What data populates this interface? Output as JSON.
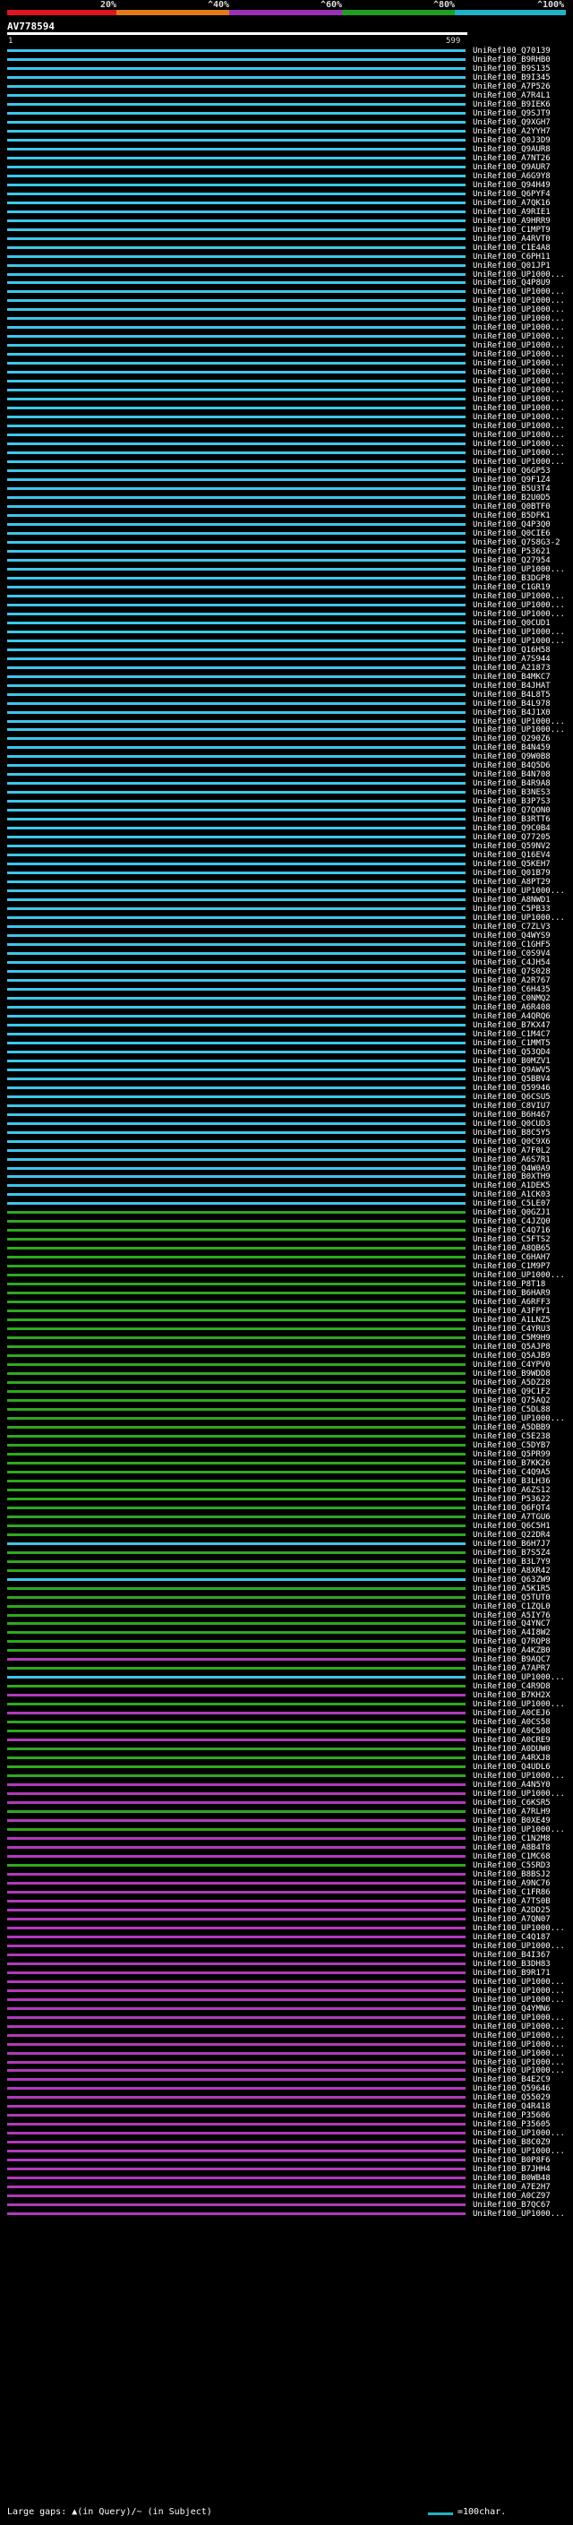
{
  "scale_colors": [
    "#e0141e",
    "#e07b1a",
    "#9b2fb8",
    "#1f9e1f",
    "#20b2c8"
  ],
  "scale_labels": [
    "20%",
    "^40%",
    "^60%",
    "^80%",
    "^100%"
  ],
  "query": {
    "name": "AV778594",
    "start": "1",
    "end": "599"
  },
  "hit_colors": {
    "cyan": "#3ec6ea",
    "green": "#2fa81f",
    "magenta": "#b23aba"
  },
  "hits": [
    {
      "label": "UniRef100_Q70139",
      "c": "cyan"
    },
    {
      "label": "UniRef100_B9RHB0",
      "c": "cyan"
    },
    {
      "label": "UniRef100_B9S135",
      "c": "cyan"
    },
    {
      "label": "UniRef100_B9I345",
      "c": "cyan"
    },
    {
      "label": "UniRef100_A7P526",
      "c": "cyan"
    },
    {
      "label": "UniRef100_A7R4L1",
      "c": "cyan"
    },
    {
      "label": "UniRef100_B9IEK6",
      "c": "cyan"
    },
    {
      "label": "UniRef100_Q9SJT9",
      "c": "cyan"
    },
    {
      "label": "UniRef100_Q9XGH7",
      "c": "cyan"
    },
    {
      "label": "UniRef100_A2YYH7",
      "c": "cyan"
    },
    {
      "label": "UniRef100_Q0J3D9",
      "c": "cyan"
    },
    {
      "label": "UniRef100_Q9AUR8",
      "c": "cyan"
    },
    {
      "label": "UniRef100_A7NT26",
      "c": "cyan"
    },
    {
      "label": "UniRef100_Q9AUR7",
      "c": "cyan"
    },
    {
      "label": "UniRef100_A6G9Y8",
      "c": "cyan"
    },
    {
      "label": "UniRef100_Q94H49",
      "c": "cyan"
    },
    {
      "label": "UniRef100_Q6PYF4",
      "c": "cyan"
    },
    {
      "label": "UniRef100_A7QK16",
      "c": "cyan"
    },
    {
      "label": "UniRef100_A9RIE1",
      "c": "cyan"
    },
    {
      "label": "UniRef100_A9HRR9",
      "c": "cyan"
    },
    {
      "label": "UniRef100_C1MPT9",
      "c": "cyan"
    },
    {
      "label": "UniRef100_A4RVT0",
      "c": "cyan"
    },
    {
      "label": "UniRef100_C1E4A8",
      "c": "cyan"
    },
    {
      "label": "UniRef100_C6PH11",
      "c": "cyan"
    },
    {
      "label": "UniRef100_Q01JP1",
      "c": "cyan"
    },
    {
      "label": "UniRef100_UP1000...",
      "c": "cyan"
    },
    {
      "label": "UniRef100_Q4P8U9",
      "c": "cyan"
    },
    {
      "label": "UniRef100_UP1000...",
      "c": "cyan"
    },
    {
      "label": "UniRef100_UP1000...",
      "c": "cyan"
    },
    {
      "label": "UniRef100_UP1000...",
      "c": "cyan"
    },
    {
      "label": "UniRef100_UP1000...",
      "c": "cyan"
    },
    {
      "label": "UniRef100_UP1000...",
      "c": "cyan"
    },
    {
      "label": "UniRef100_UP1000...",
      "c": "cyan"
    },
    {
      "label": "UniRef100_UP1000...",
      "c": "cyan"
    },
    {
      "label": "UniRef100_UP1000...",
      "c": "cyan"
    },
    {
      "label": "UniRef100_UP1000...",
      "c": "cyan"
    },
    {
      "label": "UniRef100_UP1000...",
      "c": "cyan"
    },
    {
      "label": "UniRef100_UP1000...",
      "c": "cyan"
    },
    {
      "label": "UniRef100_UP1000...",
      "c": "cyan"
    },
    {
      "label": "UniRef100_UP1000...",
      "c": "cyan"
    },
    {
      "label": "UniRef100_UP1000...",
      "c": "cyan"
    },
    {
      "label": "UniRef100_UP1000...",
      "c": "cyan"
    },
    {
      "label": "UniRef100_UP1000...",
      "c": "cyan"
    },
    {
      "label": "UniRef100_UP1000...",
      "c": "cyan"
    },
    {
      "label": "UniRef100_UP1000...",
      "c": "cyan"
    },
    {
      "label": "UniRef100_UP1000...",
      "c": "cyan"
    },
    {
      "label": "UniRef100_UP1000...",
      "c": "cyan"
    },
    {
      "label": "UniRef100_Q6GP53",
      "c": "cyan"
    },
    {
      "label": "UniRef100_Q9F1Z4",
      "c": "cyan"
    },
    {
      "label": "UniRef100_B5U3T4",
      "c": "cyan"
    },
    {
      "label": "UniRef100_B2U0D5",
      "c": "cyan"
    },
    {
      "label": "UniRef100_Q0BTF0",
      "c": "cyan"
    },
    {
      "label": "UniRef100_B5DFK1",
      "c": "cyan"
    },
    {
      "label": "UniRef100_Q4P3Q0",
      "c": "cyan"
    },
    {
      "label": "UniRef100_Q0CIE6",
      "c": "cyan"
    },
    {
      "label": "UniRef100_Q7S8G3-2",
      "c": "cyan"
    },
    {
      "label": "UniRef100_P53621",
      "c": "cyan"
    },
    {
      "label": "UniRef100_Q27954",
      "c": "cyan"
    },
    {
      "label": "UniRef100_UP1000...",
      "c": "cyan"
    },
    {
      "label": "UniRef100_B3DGP8",
      "c": "cyan"
    },
    {
      "label": "UniRef100_C1GR19",
      "c": "cyan"
    },
    {
      "label": "UniRef100_UP1000...",
      "c": "cyan"
    },
    {
      "label": "UniRef100_UP1000...",
      "c": "cyan"
    },
    {
      "label": "UniRef100_UP1000...",
      "c": "cyan"
    },
    {
      "label": "UniRef100_Q0CUD1",
      "c": "cyan"
    },
    {
      "label": "UniRef100_UP1000...",
      "c": "cyan"
    },
    {
      "label": "UniRef100_UP1000...",
      "c": "cyan"
    },
    {
      "label": "UniRef100_Q16H58",
      "c": "cyan"
    },
    {
      "label": "UniRef100_A7S944",
      "c": "cyan"
    },
    {
      "label": "UniRef100_A21873",
      "c": "cyan"
    },
    {
      "label": "UniRef100_B4MKC7",
      "c": "cyan"
    },
    {
      "label": "UniRef100_B4JHAT",
      "c": "cyan"
    },
    {
      "label": "UniRef100_B4L8T5",
      "c": "cyan"
    },
    {
      "label": "UniRef100_B4L978",
      "c": "cyan"
    },
    {
      "label": "UniRef100_B4J1X0",
      "c": "cyan"
    },
    {
      "label": "UniRef100_UP1000...",
      "c": "cyan"
    },
    {
      "label": "UniRef100_UP1000...",
      "c": "cyan"
    },
    {
      "label": "UniRef100_Q290Z6",
      "c": "cyan"
    },
    {
      "label": "UniRef100_B4N459",
      "c": "cyan"
    },
    {
      "label": "UniRef100_Q9W0B8",
      "c": "cyan"
    },
    {
      "label": "UniRef100_B4Q5D6",
      "c": "cyan"
    },
    {
      "label": "UniRef100_B4N708",
      "c": "cyan"
    },
    {
      "label": "UniRef100_B4R9A8",
      "c": "cyan"
    },
    {
      "label": "UniRef100_B3NES3",
      "c": "cyan"
    },
    {
      "label": "UniRef100_B3P7S3",
      "c": "cyan"
    },
    {
      "label": "UniRef100_Q7QON0",
      "c": "cyan"
    },
    {
      "label": "UniRef100_B3RTT6",
      "c": "cyan"
    },
    {
      "label": "UniRef100_Q9C0B4",
      "c": "cyan"
    },
    {
      "label": "UniRef100_Q77205",
      "c": "cyan"
    },
    {
      "label": "UniRef100_Q59NV2",
      "c": "cyan"
    },
    {
      "label": "UniRef100_Q16EV4",
      "c": "cyan"
    },
    {
      "label": "UniRef100_Q5KEH7",
      "c": "cyan"
    },
    {
      "label": "UniRef100_Q01B79",
      "c": "cyan"
    },
    {
      "label": "UniRef100_A8PT29",
      "c": "cyan"
    },
    {
      "label": "UniRef100_UP1000...",
      "c": "cyan"
    },
    {
      "label": "UniRef100_A8NWD1",
      "c": "cyan"
    },
    {
      "label": "UniRef100_C5PB33",
      "c": "cyan"
    },
    {
      "label": "UniRef100_UP1000...",
      "c": "cyan"
    },
    {
      "label": "UniRef100_C7ZLV3",
      "c": "cyan"
    },
    {
      "label": "UniRef100_Q4WYS9",
      "c": "cyan"
    },
    {
      "label": "UniRef100_C1GHF5",
      "c": "cyan"
    },
    {
      "label": "UniRef100_C0S9V4",
      "c": "cyan"
    },
    {
      "label": "UniRef100_C4JH54",
      "c": "cyan"
    },
    {
      "label": "UniRef100_Q7S028",
      "c": "cyan"
    },
    {
      "label": "UniRef100_A2R767",
      "c": "cyan"
    },
    {
      "label": "UniRef100_C6H435",
      "c": "cyan"
    },
    {
      "label": "UniRef100_C0NMQ2",
      "c": "cyan"
    },
    {
      "label": "UniRef100_A6R408",
      "c": "cyan"
    },
    {
      "label": "UniRef100_A4QRQ6",
      "c": "cyan"
    },
    {
      "label": "UniRef100_B7KX47",
      "c": "cyan"
    },
    {
      "label": "UniRef100_C1M4C7",
      "c": "cyan"
    },
    {
      "label": "UniRef100_C1MMT5",
      "c": "cyan"
    },
    {
      "label": "UniRef100_Q53QD4",
      "c": "cyan"
    },
    {
      "label": "UniRef100_B0MZV1",
      "c": "cyan"
    },
    {
      "label": "UniRef100_Q9AWV5",
      "c": "cyan"
    },
    {
      "label": "UniRef100_Q5BBV4",
      "c": "cyan"
    },
    {
      "label": "UniRef100_Q59946",
      "c": "cyan"
    },
    {
      "label": "UniRef100_Q6CSU5",
      "c": "cyan"
    },
    {
      "label": "UniRef100_C8VIU7",
      "c": "cyan"
    },
    {
      "label": "UniRef100_B6H467",
      "c": "cyan"
    },
    {
      "label": "UniRef100_Q0CUD3",
      "c": "cyan"
    },
    {
      "label": "UniRef100_B8C5Y5",
      "c": "cyan"
    },
    {
      "label": "UniRef100_Q0C9X6",
      "c": "cyan"
    },
    {
      "label": "UniRef100_A7F0L2",
      "c": "cyan"
    },
    {
      "label": "UniRef100_A6S7R1",
      "c": "cyan"
    },
    {
      "label": "UniRef100_Q4W0A9",
      "c": "cyan"
    },
    {
      "label": "UniRef100_B0XTH9",
      "c": "cyan"
    },
    {
      "label": "UniRef100_A1DEK5",
      "c": "cyan"
    },
    {
      "label": "UniRef100_A1CK03",
      "c": "cyan"
    },
    {
      "label": "UniRef100_C5LE07",
      "c": "cyan"
    },
    {
      "label": "UniRef100_Q0GZJ1",
      "c": "green"
    },
    {
      "label": "UniRef100_C4JZQ0",
      "c": "green"
    },
    {
      "label": "UniRef100_C4Q716",
      "c": "green"
    },
    {
      "label": "UniRef100_C5FTS2",
      "c": "green"
    },
    {
      "label": "UniRef100_A8QB65",
      "c": "green"
    },
    {
      "label": "UniRef100_C6HAH7",
      "c": "green"
    },
    {
      "label": "UniRef100_C1M9P7",
      "c": "green"
    },
    {
      "label": "UniRef100_UP1000...",
      "c": "green"
    },
    {
      "label": "UniRef100_P8T18",
      "c": "green"
    },
    {
      "label": "UniRef100_B6HAR9",
      "c": "green"
    },
    {
      "label": "UniRef100_A6RFF3",
      "c": "green"
    },
    {
      "label": "UniRef100_A3FPY1",
      "c": "green"
    },
    {
      "label": "UniRef100_A1LNZ5",
      "c": "green"
    },
    {
      "label": "UniRef100_C4YRU3",
      "c": "green"
    },
    {
      "label": "UniRef100_C5M9H9",
      "c": "green"
    },
    {
      "label": "UniRef100_Q5AJP8",
      "c": "green"
    },
    {
      "label": "UniRef100_Q5AJB9",
      "c": "green"
    },
    {
      "label": "UniRef100_C4YPV0",
      "c": "green"
    },
    {
      "label": "UniRef100_B9WDD8",
      "c": "green"
    },
    {
      "label": "UniRef100_A5DZ28",
      "c": "green"
    },
    {
      "label": "UniRef100_Q9C1F2",
      "c": "green"
    },
    {
      "label": "UniRef100_Q75AQ2",
      "c": "green"
    },
    {
      "label": "UniRef100_C5DL88",
      "c": "green"
    },
    {
      "label": "UniRef100_UP1000...",
      "c": "green"
    },
    {
      "label": "UniRef100_A5DBB9",
      "c": "green"
    },
    {
      "label": "UniRef100_C5E238",
      "c": "green"
    },
    {
      "label": "UniRef100_C5DYB7",
      "c": "green"
    },
    {
      "label": "UniRef100_Q5PR99",
      "c": "green"
    },
    {
      "label": "UniRef100_B7KK26",
      "c": "green"
    },
    {
      "label": "UniRef100_C4Q9A5",
      "c": "green"
    },
    {
      "label": "UniRef100_B3LH36",
      "c": "green"
    },
    {
      "label": "UniRef100_A6ZS12",
      "c": "green"
    },
    {
      "label": "UniRef100_P53622",
      "c": "green"
    },
    {
      "label": "UniRef100_Q6FQT4",
      "c": "green"
    },
    {
      "label": "UniRef100_A7TGU6",
      "c": "green"
    },
    {
      "label": "UniRef100_Q6C5H1",
      "c": "green"
    },
    {
      "label": "UniRef100_Q22DR4",
      "c": "green"
    },
    {
      "label": "UniRef100_B6H7J7",
      "c": "cyan"
    },
    {
      "label": "UniRef100_B7S5Z4",
      "c": "green"
    },
    {
      "label": "UniRef100_B3L7Y9",
      "c": "green"
    },
    {
      "label": "UniRef100_A8XR42",
      "c": "green"
    },
    {
      "label": "UniRef100_Q63ZW9",
      "c": "cyan"
    },
    {
      "label": "UniRef100_A5K1R5",
      "c": "green"
    },
    {
      "label": "UniRef100_Q5TUT0",
      "c": "green"
    },
    {
      "label": "UniRef100_C1ZQL0",
      "c": "green"
    },
    {
      "label": "UniRef100_A5IY76",
      "c": "green"
    },
    {
      "label": "UniRef100_Q4YNC7",
      "c": "green"
    },
    {
      "label": "UniRef100_A4I8W2",
      "c": "green"
    },
    {
      "label": "UniRef100_Q7RQP8",
      "c": "green"
    },
    {
      "label": "UniRef100_A4KZB0",
      "c": "green"
    },
    {
      "label": "UniRef100_B9AQC7",
      "c": "magenta"
    },
    {
      "label": "UniRef100_A7APR7",
      "c": "green"
    },
    {
      "label": "UniRef100_UP1000...",
      "c": "cyan"
    },
    {
      "label": "UniRef100_C4R9D8",
      "c": "green"
    },
    {
      "label": "UniRef100_B7KH2X",
      "c": "magenta"
    },
    {
      "label": "UniRef100_UP1000...",
      "c": "green"
    },
    {
      "label": "UniRef100_A0CEJ6",
      "c": "magenta"
    },
    {
      "label": "UniRef100_A0CS58",
      "c": "green"
    },
    {
      "label": "UniRef100_A0C508",
      "c": "green"
    },
    {
      "label": "UniRef100_A0CRE9",
      "c": "magenta"
    },
    {
      "label": "UniRef100_A0DUW0",
      "c": "green"
    },
    {
      "label": "UniRef100_A4RXJ8",
      "c": "green"
    },
    {
      "label": "UniRef100_Q4UDL6",
      "c": "green"
    },
    {
      "label": "UniRef100_UP1000...",
      "c": "green"
    },
    {
      "label": "UniRef100_A4N5Y0",
      "c": "magenta"
    },
    {
      "label": "UniRef100_UP1000...",
      "c": "magenta"
    },
    {
      "label": "UniRef100_C6KSR5",
      "c": "magenta"
    },
    {
      "label": "UniRef100_A7RLH9",
      "c": "green"
    },
    {
      "label": "UniRef100_B0XE49",
      "c": "magenta"
    },
    {
      "label": "UniRef100_UP1000...",
      "c": "green"
    },
    {
      "label": "UniRef100_C1N2M8",
      "c": "magenta"
    },
    {
      "label": "UniRef100_A8B4T8",
      "c": "magenta"
    },
    {
      "label": "UniRef100_C1MC68",
      "c": "magenta"
    },
    {
      "label": "UniRef100_C5SRD3",
      "c": "green"
    },
    {
      "label": "UniRef100_B8BSJ2",
      "c": "magenta"
    },
    {
      "label": "UniRef100_A9NC76",
      "c": "magenta"
    },
    {
      "label": "UniRef100_C1FR86",
      "c": "magenta"
    },
    {
      "label": "UniRef100_A7TS0B",
      "c": "magenta"
    },
    {
      "label": "UniRef100_A2DD25",
      "c": "magenta"
    },
    {
      "label": "UniRef100_A7QN07",
      "c": "magenta"
    },
    {
      "label": "UniRef100_UP1000...",
      "c": "magenta"
    },
    {
      "label": "UniRef100_C4Q187",
      "c": "magenta"
    },
    {
      "label": "UniRef100_UP1000...",
      "c": "magenta"
    },
    {
      "label": "UniRef100_B4I367",
      "c": "magenta"
    },
    {
      "label": "UniRef100_B3DH83",
      "c": "magenta"
    },
    {
      "label": "UniRef100_B9R171",
      "c": "magenta"
    },
    {
      "label": "UniRef100_UP1000...",
      "c": "magenta"
    },
    {
      "label": "UniRef100_UP1000...",
      "c": "magenta"
    },
    {
      "label": "UniRef100_UP1000...",
      "c": "magenta"
    },
    {
      "label": "UniRef100_Q4YMN6",
      "c": "magenta"
    },
    {
      "label": "UniRef100_UP1000...",
      "c": "magenta"
    },
    {
      "label": "UniRef100_UP1000...",
      "c": "magenta"
    },
    {
      "label": "UniRef100_UP1000...",
      "c": "magenta"
    },
    {
      "label": "UniRef100_UP1000...",
      "c": "magenta"
    },
    {
      "label": "UniRef100_UP1000...",
      "c": "magenta"
    },
    {
      "label": "UniRef100_UP1000...",
      "c": "magenta"
    },
    {
      "label": "UniRef100_UP1000...",
      "c": "magenta"
    },
    {
      "label": "UniRef100_B4E2C9",
      "c": "magenta"
    },
    {
      "label": "UniRef100_Q59646",
      "c": "magenta"
    },
    {
      "label": "UniRef100_Q55029",
      "c": "magenta"
    },
    {
      "label": "UniRef100_Q4R418",
      "c": "magenta"
    },
    {
      "label": "UniRef100_P35606",
      "c": "magenta"
    },
    {
      "label": "UniRef100_P35605",
      "c": "magenta"
    },
    {
      "label": "UniRef100_UP1000...",
      "c": "magenta"
    },
    {
      "label": "UniRef100_B8C0Z9",
      "c": "magenta"
    },
    {
      "label": "UniRef100_UP1000...",
      "c": "magenta"
    },
    {
      "label": "UniRef100_B0P8F6",
      "c": "magenta"
    },
    {
      "label": "UniRef100_B7JHH4",
      "c": "magenta"
    },
    {
      "label": "UniRef100_B0WB48",
      "c": "magenta"
    },
    {
      "label": "UniRef100_A7E2H7",
      "c": "magenta"
    },
    {
      "label": "UniRef100_A0CZ97",
      "c": "magenta"
    },
    {
      "label": "UniRef100_B7QC67",
      "c": "magenta"
    },
    {
      "label": "UniRef100_UP1000...",
      "c": "magenta"
    }
  ],
  "legend": {
    "gaps_text": "Large gaps: ▲(in Query)/~ (in Subject)",
    "scale_text": "=100char."
  }
}
